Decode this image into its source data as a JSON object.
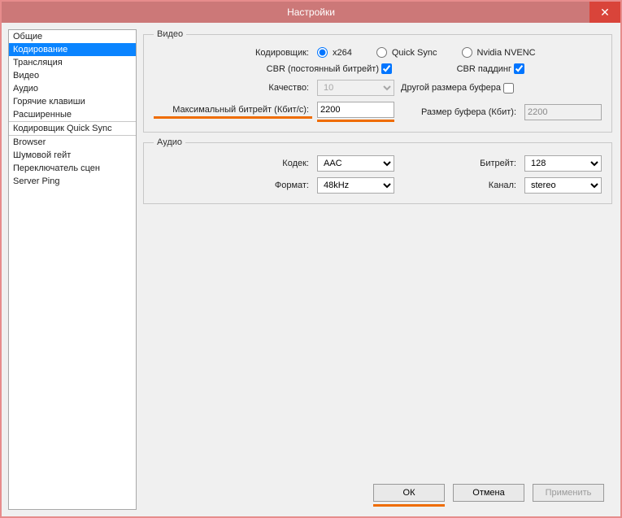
{
  "window": {
    "title": "Настройки",
    "close_glyph": "✕"
  },
  "sidebar": {
    "groups": [
      [
        "Общие",
        "Кодирование",
        "Трансляция",
        "Видео",
        "Аудио",
        "Горячие клавиши",
        "Расширенные"
      ],
      [
        "Кодировщик Quick Sync"
      ],
      [
        "Browser",
        "Шумовой гейт",
        "Переключатель сцен",
        "Server Ping"
      ]
    ],
    "selected": "Кодирование"
  },
  "video": {
    "legend": "Видео",
    "encoder_label": "Кодировщик:",
    "encoders": {
      "x264": "x264",
      "quicksync": "Quick Sync",
      "nvenc": "Nvidia NVENC",
      "selected": "x264"
    },
    "cbr_label": "CBR (постоянный битрейт)",
    "cbr_checked": true,
    "cbr_padding_label": "CBR паддинг",
    "cbr_padding_checked": true,
    "quality_label": "Качество:",
    "quality_value": "10",
    "altbuf_label": "Другой размера буфера",
    "altbuf_checked": false,
    "maxbitrate_label": "Максимальный битрейт (Кбит/с):",
    "maxbitrate_value": "2200",
    "bufsize_label": "Размер буфера (Кбит):",
    "bufsize_value": "2200"
  },
  "audio": {
    "legend": "Аудио",
    "codec_label": "Кодек:",
    "codec_value": "AAC",
    "bitrate_label": "Битрейт:",
    "bitrate_value": "128",
    "format_label": "Формат:",
    "format_value": "48kHz",
    "channel_label": "Канал:",
    "channel_value": "stereo"
  },
  "buttons": {
    "ok": "ОК",
    "cancel": "Отмена",
    "apply": "Применить"
  }
}
